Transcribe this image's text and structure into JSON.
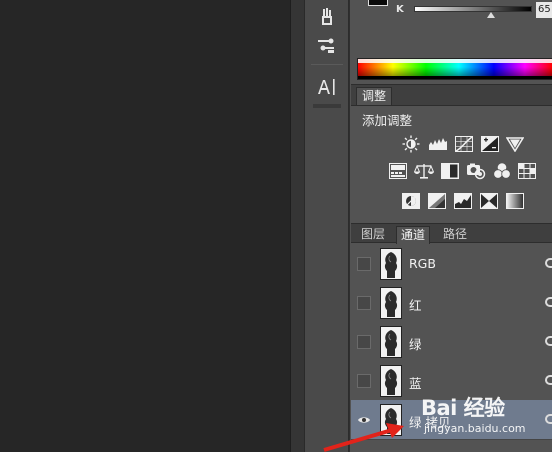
{
  "colors": {
    "canvas": "#262626",
    "panel": "#535353",
    "selected_row": "#6f7b8e",
    "annotation_arrow": "#e2231a"
  },
  "color_panel": {
    "channel_label": "K",
    "value": "65"
  },
  "toolbar": {
    "icons": [
      "brush-presets-icon",
      "clone-source-icon",
      "character-panel-icon"
    ]
  },
  "adjustments": {
    "tab_label": "调整",
    "title": "添加调整",
    "icons": [
      "brightness-contrast-icon",
      "levels-icon",
      "curves-icon",
      "exposure-icon",
      "vibrance-icon",
      "hue-saturation-icon",
      "color-balance-icon",
      "black-white-icon",
      "photo-filter-icon",
      "channel-mixer-icon",
      "color-lookup-icon",
      "invert-icon",
      "posterize-icon",
      "threshold-icon",
      "selective-color-icon",
      "gradient-map-icon"
    ]
  },
  "layers_panel": {
    "tabs": [
      {
        "label": "图层",
        "active": false
      },
      {
        "label": "通道",
        "active": true
      },
      {
        "label": "路径",
        "active": false
      }
    ],
    "channels": [
      {
        "name": "RGB",
        "visible": false,
        "selected": false
      },
      {
        "name": "红",
        "visible": false,
        "selected": false
      },
      {
        "name": "绿",
        "visible": false,
        "selected": false
      },
      {
        "name": "蓝",
        "visible": false,
        "selected": false
      },
      {
        "name": "绿 拷贝",
        "visible": true,
        "selected": true
      }
    ]
  },
  "watermark": {
    "brand": "Bai 经验",
    "site": "jingyan.baidu.com"
  }
}
